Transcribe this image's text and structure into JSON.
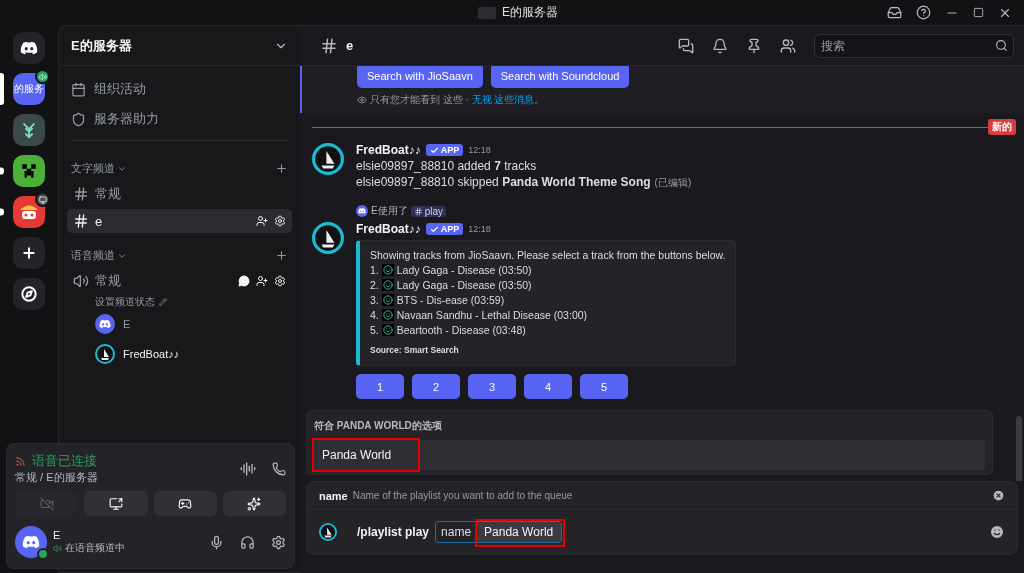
{
  "window": {
    "title": "E的服务器"
  },
  "servers": [
    {
      "kind": "home",
      "selected": false,
      "unread": false
    },
    {
      "kind": "server",
      "name": "的服务",
      "speaking": true,
      "streaming": false,
      "selected": true,
      "unread": false
    },
    {
      "kind": "tree",
      "selected": false,
      "unread": false
    },
    {
      "kind": "creeper",
      "selected": false,
      "unread": true
    },
    {
      "kind": "pirate",
      "speaking": false,
      "streaming": true,
      "selected": false,
      "unread": true
    },
    {
      "kind": "add",
      "selected": false,
      "unread": false
    },
    {
      "kind": "explore",
      "selected": false,
      "unread": false
    }
  ],
  "sidebar": {
    "server_name": "E的服务器",
    "links": [
      {
        "kind": "calendar",
        "label": "组织活动"
      },
      {
        "kind": "boost",
        "label": "服务器助力"
      }
    ],
    "categories": [
      {
        "name": "文字频道",
        "kind": "text",
        "channels": [
          {
            "name": "常规",
            "selected": false
          },
          {
            "name": "e",
            "selected": true
          }
        ]
      },
      {
        "name": "语音频道",
        "kind": "voice",
        "channels": [
          {
            "name": "常规",
            "selected": false,
            "status": "设置频道状态",
            "members": [
              {
                "name": "E",
                "kind": "user"
              },
              {
                "name": "FredBoat♪♪",
                "kind": "bot"
              }
            ]
          }
        ]
      }
    ]
  },
  "voice_panel": {
    "status": "语音已连接",
    "location": "常规 / E的服务器",
    "buttons": [
      {
        "kind": "camera",
        "disabled": true
      },
      {
        "kind": "screen",
        "disabled": false
      },
      {
        "kind": "activity",
        "disabled": false
      },
      {
        "kind": "soundboard",
        "disabled": false
      }
    ]
  },
  "user": {
    "name": "E",
    "status": "在语音频道中"
  },
  "channel": {
    "name": "e",
    "search_placeholder": "搜索"
  },
  "ephemeral": {
    "buttons": [
      "Search with JioSaavn",
      "Search with Soundcloud"
    ],
    "notice": "只有您才能看到 这些 · ",
    "dismiss": "无视 这些消息",
    "end": "。"
  },
  "divider": {
    "label": "新的"
  },
  "messages": [
    {
      "author": "FredBoat♪♪",
      "tag": "APP",
      "time": "12:18",
      "lines": [
        "elsie09897_88810 added **7** tracks",
        "elsie09897_88810 skipped **Panda World Theme Song**"
      ],
      "edited": "(已编辑)"
    },
    {
      "author": "FredBoat♪♪",
      "tag": "APP",
      "time": "12:18",
      "reply": {
        "user": "E使用了",
        "command": "play"
      },
      "embed": {
        "description": "Showing tracks from JioSaavn. Please select a track from the buttons below.",
        "tracks": [
          {
            "number": "1.",
            "title": "Lady Gaga - Disease (03:50)"
          },
          {
            "number": "2.",
            "title": "Lady Gaga - Disease (03:50)"
          },
          {
            "number": "3.",
            "title": "BTS - Dis-ease (03:59)"
          },
          {
            "number": "4.",
            "title": "Navaan Sandhu - Lethal Disease (03:00)"
          },
          {
            "number": "5.",
            "title": "Beartooth - Disease (03:48)"
          }
        ],
        "footer": "Source: Smart Search"
      },
      "buttons": [
        "1",
        "2",
        "3",
        "4",
        "5"
      ]
    }
  ],
  "autocomplete": {
    "title": "符合 PANDA WORLD的选项",
    "options": [
      {
        "label": "Panda World",
        "selected": true,
        "highlighted": true
      }
    ]
  },
  "input": {
    "option_name": "name",
    "option_hint": "Name of the playlist you want to add to the queue",
    "command": "/playlist play",
    "param_name": "name",
    "param_value": "Panda World",
    "param_highlighted": true
  }
}
